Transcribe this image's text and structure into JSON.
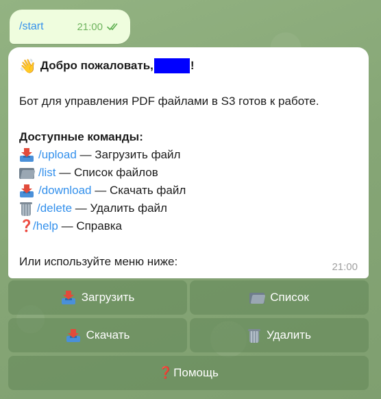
{
  "outgoing": {
    "text": "/start",
    "time": "21:00"
  },
  "message": {
    "greeting": "Добро пожаловать,",
    "greeting_end": "!",
    "intro": "Бот для управления PDF файлами в S3 готов к работе.",
    "commands_header": "Доступные команды:",
    "commands": [
      {
        "icon": "upload-icon",
        "command": "/upload",
        "description": " — Загрузить файл"
      },
      {
        "icon": "folder-icon",
        "command": "/list",
        "description": " — Список файлов"
      },
      {
        "icon": "download-icon",
        "command": "/download",
        "description": " — Скачать файл"
      },
      {
        "icon": "trash-icon",
        "command": "/delete",
        "description": " — Удалить файл"
      },
      {
        "icon": "question-icon",
        "command": "/help",
        "description": " — Справка"
      }
    ],
    "footer": "Или используйте меню ниже:",
    "time": "21:00"
  },
  "keyboard": {
    "rows": [
      [
        {
          "icon": "upload-icon",
          "label": "Загрузить"
        },
        {
          "icon": "folder-icon",
          "label": "Список"
        }
      ],
      [
        {
          "icon": "download-icon",
          "label": "Скачать"
        },
        {
          "icon": "trash-icon",
          "label": "Удалить"
        }
      ],
      [
        {
          "icon": "question-icon",
          "label": "Помощь"
        }
      ]
    ]
  },
  "colors": {
    "link": "#3390ec",
    "background": "#8aa979",
    "outgoing_bubble": "#effdde",
    "redaction": "#0000ff"
  }
}
